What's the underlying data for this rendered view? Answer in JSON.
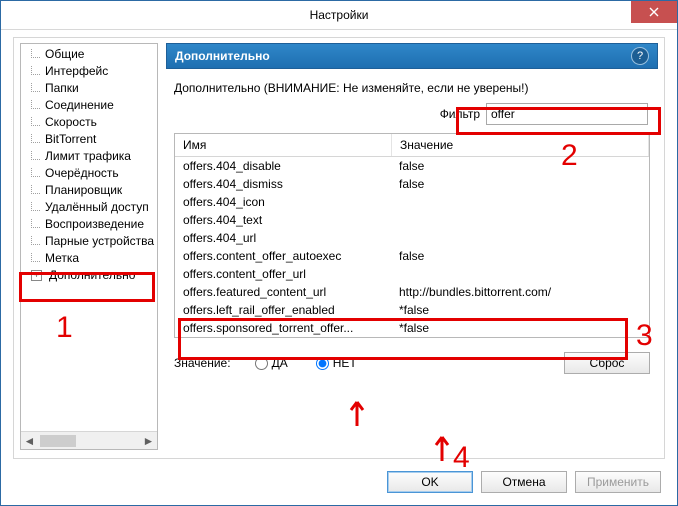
{
  "window": {
    "title": "Настройки"
  },
  "sidebar": {
    "items": [
      {
        "label": "Общие"
      },
      {
        "label": "Интерфейс"
      },
      {
        "label": "Папки"
      },
      {
        "label": "Соединение"
      },
      {
        "label": "Скорость"
      },
      {
        "label": "BitTorrent"
      },
      {
        "label": "Лимит трафика"
      },
      {
        "label": "Очерёдность"
      },
      {
        "label": "Планировщик"
      },
      {
        "label": "Удалённый доступ"
      },
      {
        "label": "Воспроизведение"
      },
      {
        "label": "Парные устройства"
      },
      {
        "label": "Метка"
      },
      {
        "label": "Дополнительно"
      }
    ]
  },
  "pane": {
    "title": "Дополнительно",
    "warning": "Дополнительно (ВНИМАНИЕ: Не изменяйте, если не уверены!)",
    "filter_label": "Фильтр",
    "filter_value": "offer",
    "columns": {
      "name": "Имя",
      "value": "Значение"
    },
    "rows": [
      {
        "name": "offers.404_disable",
        "value": "false"
      },
      {
        "name": "offers.404_dismiss",
        "value": "false"
      },
      {
        "name": "offers.404_icon",
        "value": ""
      },
      {
        "name": "offers.404_text",
        "value": ""
      },
      {
        "name": "offers.404_url",
        "value": ""
      },
      {
        "name": "offers.content_offer_autoexec",
        "value": "false"
      },
      {
        "name": "offers.content_offer_url",
        "value": ""
      },
      {
        "name": "offers.featured_content_url",
        "value": "http://bundles.bittorrent.com/"
      },
      {
        "name": "offers.left_rail_offer_enabled",
        "value": "*false"
      },
      {
        "name": "offers.sponsored_torrent_offer...",
        "value": "*false"
      }
    ],
    "value_label": "Значение:",
    "radio_yes": "ДА",
    "radio_no": "НЕТ",
    "reset": "Сброс"
  },
  "buttons": {
    "ok": "OK",
    "cancel": "Отмена",
    "apply": "Применить"
  },
  "anno": {
    "n1": "1",
    "n2": "2",
    "n3": "3",
    "n4": "4"
  }
}
